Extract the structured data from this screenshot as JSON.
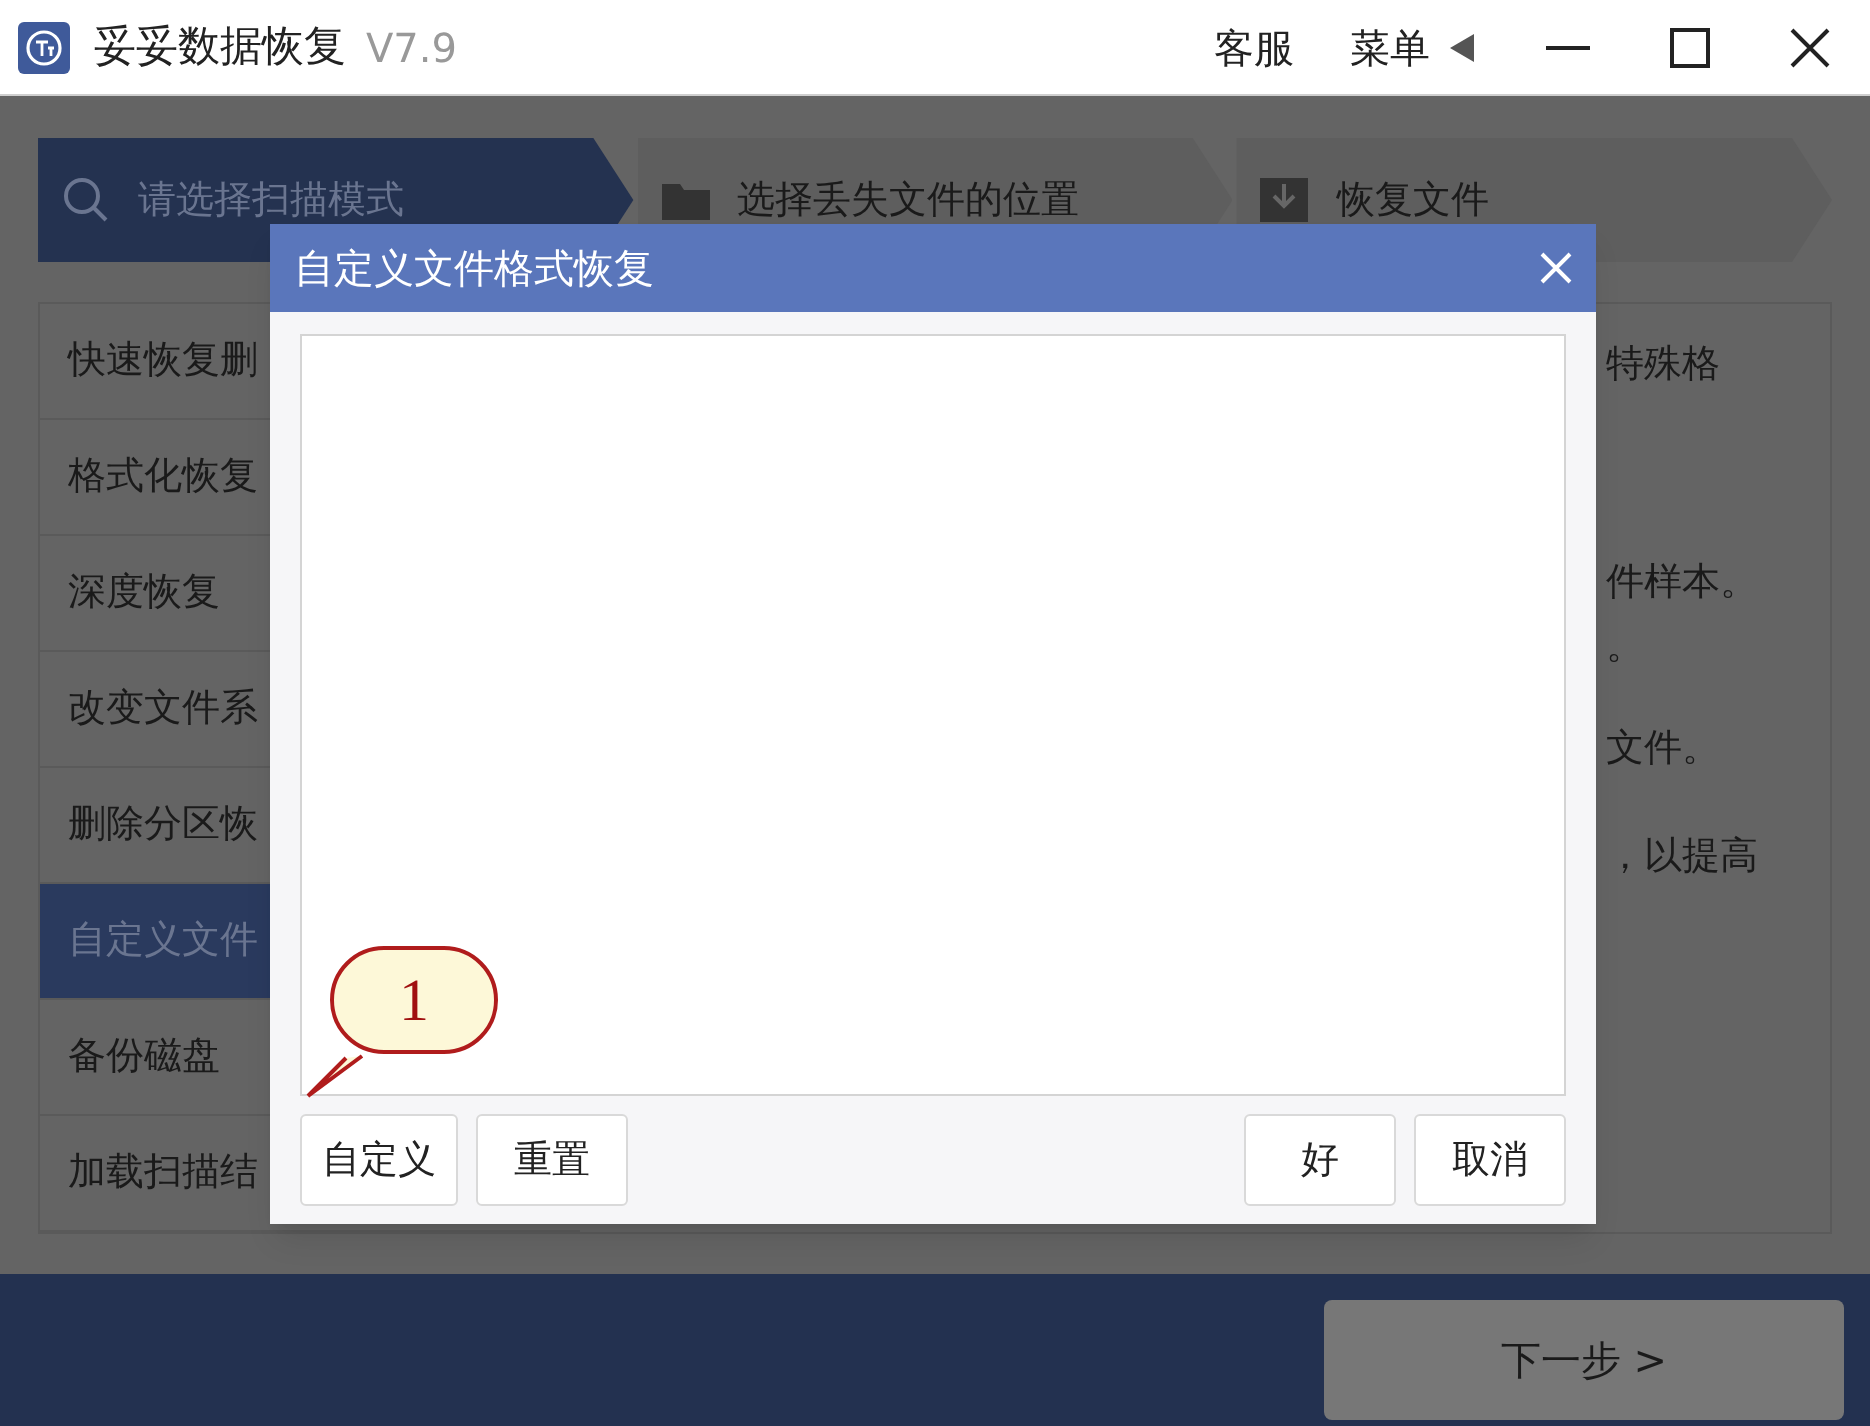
{
  "window": {
    "title": "妥妥数据恢复",
    "version": "V7.9",
    "menu_items": [
      "客服",
      "菜单"
    ]
  },
  "steps": [
    {
      "label": "请选择扫描模式",
      "selected": true
    },
    {
      "label": "选择丢失文件的位置",
      "selected": false
    },
    {
      "label": "恢复文件",
      "selected": false
    }
  ],
  "modes": [
    {
      "label": "快速恢复删",
      "selected": false
    },
    {
      "label": "格式化恢复",
      "selected": false
    },
    {
      "label": "深度恢复",
      "selected": false
    },
    {
      "label": "改变文件系",
      "selected": false
    },
    {
      "label": "删除分区恢",
      "selected": false
    },
    {
      "label": "自定义文件",
      "selected": true
    },
    {
      "label": "备份磁盘",
      "selected": false
    },
    {
      "label": "加载扫描结",
      "selected": false
    }
  ],
  "description_lines": [
    "特殊格",
    "件样本。",
    "。",
    "文件。",
    "，以提高"
  ],
  "next_button": "下一步 >",
  "dialog": {
    "title": "自定义文件格式恢复",
    "left_buttons": [
      "自定义",
      "重置"
    ],
    "right_buttons": [
      "好",
      "取消"
    ]
  },
  "callout": "1"
}
